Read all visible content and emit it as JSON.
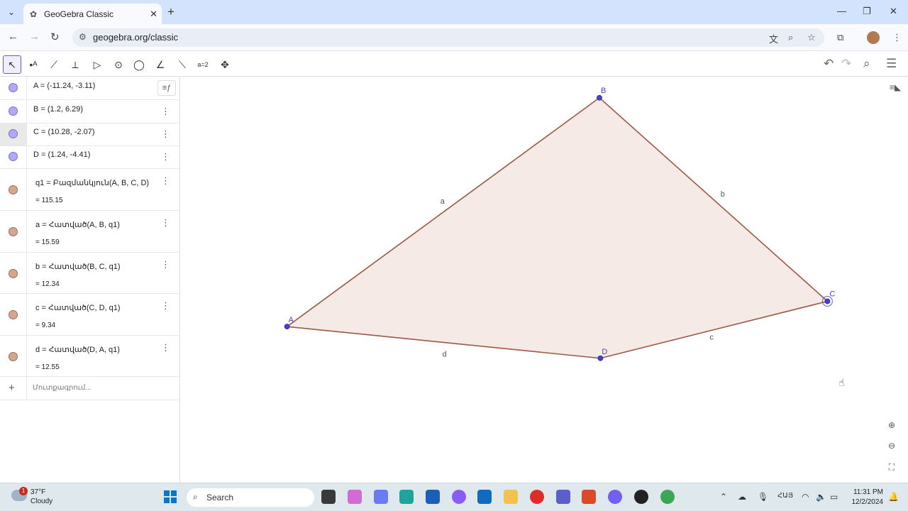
{
  "browser": {
    "tab_title": "GeoGebra Classic",
    "url": "geogebra.org/classic"
  },
  "algebra": {
    "toggle_icon": "algebra-description-toggle-icon",
    "items": [
      {
        "expr": "A = (-11.24, -3.11)",
        "value": "",
        "kind": "point"
      },
      {
        "expr": "B = (1.2, 6.29)",
        "value": "",
        "kind": "point"
      },
      {
        "expr": "C = (10.28, -2.07)",
        "value": "",
        "kind": "point"
      },
      {
        "expr": "D = (1.24, -4.41)",
        "value": "",
        "kind": "point"
      },
      {
        "expr": "q1 = Բազմանկյուն(A, B, C, D)",
        "value": "= 115.15",
        "kind": "polygon"
      },
      {
        "expr": "a = Հատված(A, B, q1)",
        "value": "= 15.59",
        "kind": "segment"
      },
      {
        "expr": "b = Հատված(B, C, q1)",
        "value": "= 12.34",
        "kind": "segment"
      },
      {
        "expr": "c = Հատված(C, D, q1)",
        "value": "= 9.34",
        "kind": "segment"
      },
      {
        "expr": "d = Հատված(D, A, q1)",
        "value": "= 12.55",
        "kind": "segment"
      }
    ],
    "input_placeholder": "Մուտքագրում..."
  },
  "graphics": {
    "points": [
      {
        "name": "A",
        "x": -11.24,
        "y": -3.11
      },
      {
        "name": "B",
        "x": 1.2,
        "y": 6.29
      },
      {
        "name": "C",
        "x": 10.28,
        "y": -2.07
      },
      {
        "name": "D",
        "x": 1.24,
        "y": -4.41
      }
    ],
    "segment_labels": [
      "a",
      "b",
      "c",
      "d"
    ],
    "colors": {
      "point": "#4a40c9",
      "polygon_fill": "#f5e6e2",
      "polygon_stroke": "#9a5a44",
      "label": "#4a40c9"
    }
  },
  "taskbar": {
    "notification_count": "1",
    "temperature": "37°F",
    "condition": "Cloudy",
    "search_label": "Search",
    "language": "ՀԱՅ",
    "time": "11:31 PM",
    "date": "12/2/2024"
  }
}
